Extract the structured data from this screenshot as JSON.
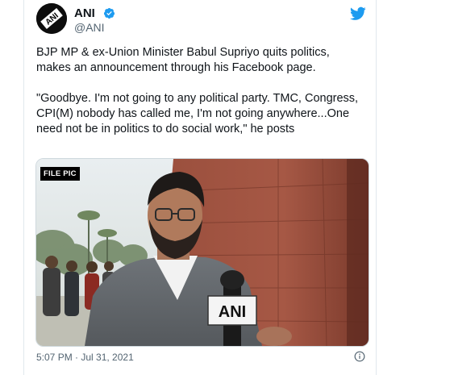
{
  "tweet": {
    "author_name": "ANI",
    "author_handle": "@ANI",
    "avatar_text": "ANI",
    "text_paragraphs": [
      "BJP MP & ex-Union Minister Babul Supriyo quits politics, makes an announcement through his Facebook page.",
      "\"Goodbye. I'm not going to any political party. TMC, Congress, CPI(M) nobody has called me, I'm not going anywhere...One need not be in politics to do social work,\" he posts"
    ],
    "media": {
      "badge": "FILE PIC",
      "mic_logo": "ANI"
    },
    "timestamp": "5:07 PM · Jul 31, 2021"
  },
  "colors": {
    "twitter_blue": "#1d9bf0",
    "secondary_text": "#536471",
    "border": "#cfd9de"
  },
  "icons": {
    "verified": "verified-badge-icon",
    "brand": "twitter-bird-icon",
    "info": "info-circle-icon"
  }
}
